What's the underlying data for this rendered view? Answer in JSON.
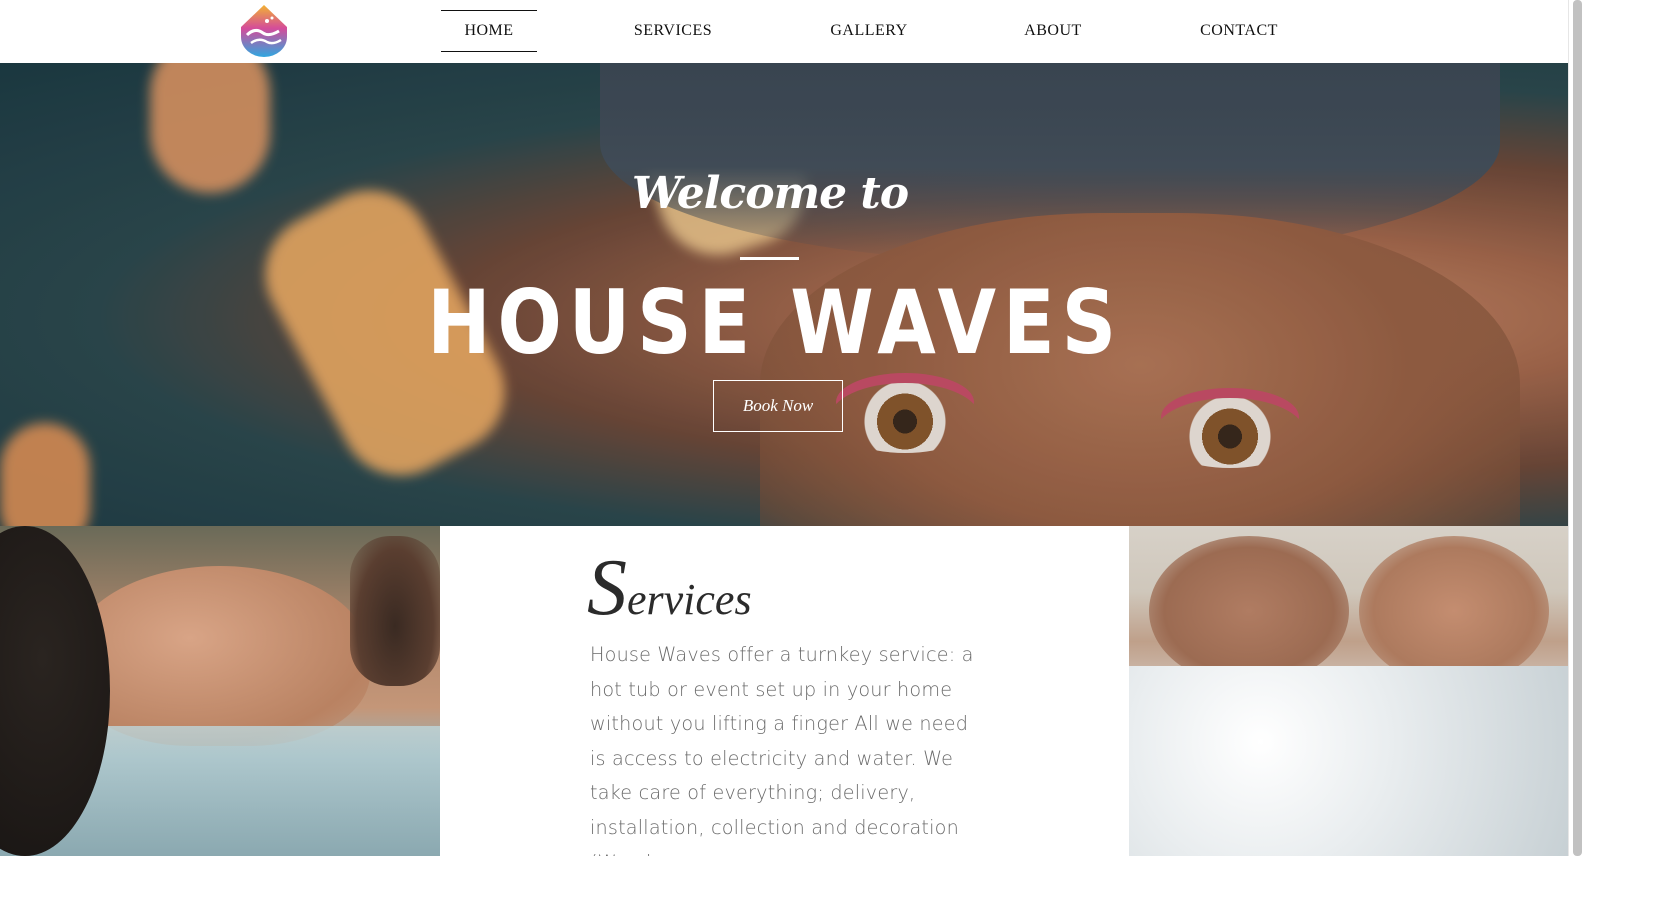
{
  "header": {
    "nav": [
      {
        "label": "HOME",
        "active": true
      },
      {
        "label": "SERVICES",
        "active": false
      },
      {
        "label": "GALLERY",
        "active": false
      },
      {
        "label": "ABOUT",
        "active": false
      },
      {
        "label": "CONTACT",
        "active": false
      }
    ]
  },
  "hero": {
    "welcome": "Welcome to",
    "title": "HOUSE WAVES",
    "cta": "Book Now"
  },
  "services": {
    "title_initial": "S",
    "title_rest": "ervices",
    "body": "House Waves offer a turnkey service: a hot tub or event set up in your home without you lifting a finger All we need is access to electricity and water. We take care of everything; delivery, installation, collection and decoration (We always"
  },
  "colors": {
    "logo_top": "#f2b233",
    "logo_mid": "#d44c9a",
    "logo_bottom": "#2fa7e0"
  }
}
